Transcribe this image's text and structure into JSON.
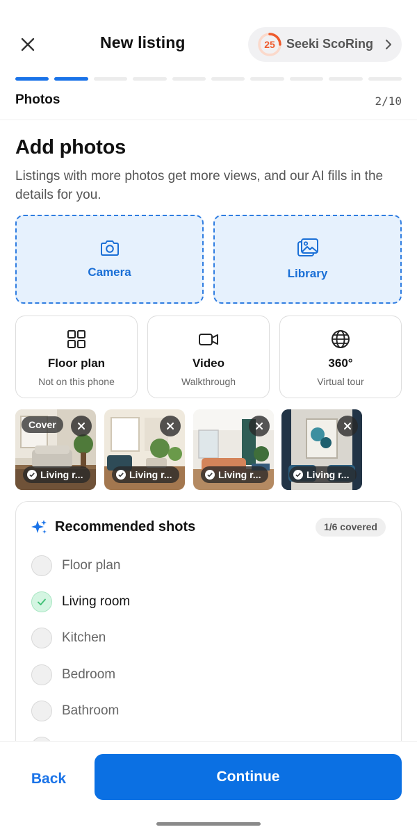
{
  "header": {
    "title": "New listing",
    "score": {
      "value": "25",
      "label": "Seeki ScoRing",
      "ring_fraction": 0.25,
      "accent": "#ee5a2c"
    }
  },
  "progress": {
    "total_steps": 10,
    "completed_steps": 2,
    "accent": "#1a73e8"
  },
  "step": {
    "label": "Photos",
    "count": "2/10"
  },
  "intro": {
    "title": "Add photos",
    "subtitle": "Listings with more photos get more views, and our AI fills in the details for you."
  },
  "sources": [
    {
      "label": "Camera",
      "icon": "camera-icon"
    },
    {
      "label": "Library",
      "icon": "image-library-icon"
    }
  ],
  "media_options": [
    {
      "title": "Floor plan",
      "subtitle": "Not on this phone",
      "icon": "grid-icon"
    },
    {
      "title": "Video",
      "subtitle": "Walkthrough",
      "icon": "video-icon"
    },
    {
      "title": "360°",
      "subtitle": "Virtual tour",
      "icon": "globe-icon"
    }
  ],
  "photos": [
    {
      "cover_label": "Cover",
      "tag": "Living r..."
    },
    {
      "tag": "Living r..."
    },
    {
      "tag": "Living r..."
    },
    {
      "tag": "Living r..."
    }
  ],
  "recommended": {
    "title": "Recommended shots",
    "badge": "1/6 covered",
    "items": [
      {
        "label": "Floor plan",
        "done": false
      },
      {
        "label": "Living room",
        "done": true
      },
      {
        "label": "Kitchen",
        "done": false
      },
      {
        "label": "Bedroom",
        "done": false
      },
      {
        "label": "Bathroom",
        "done": false
      }
    ]
  },
  "footer": {
    "back_label": "Back",
    "continue_label": "Continue",
    "primary_color": "#0b70e3"
  }
}
